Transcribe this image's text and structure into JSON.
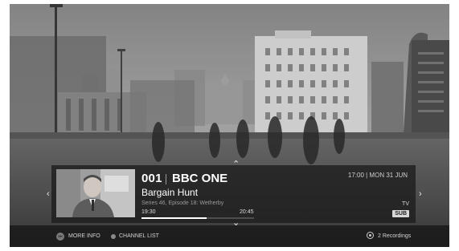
{
  "channel": {
    "number": "001",
    "name": "BBC ONE"
  },
  "programme": {
    "title": "Bargain Hunt",
    "description": "Series 46, Episode 18: Wetherby",
    "start_time": "19:30",
    "end_time": "20:45",
    "progress": 0.58
  },
  "clock": "17:00 | MON 31 JUN",
  "badges": {
    "tv": "TV",
    "sub": "SUB"
  },
  "footer": {
    "ok_label": "OK",
    "more_info": "MORE INFO",
    "channel_list": "CHANNEL LIST",
    "recordings": "2 Recordings"
  },
  "icons": {
    "up": "chevron-up-icon",
    "down": "chevron-down-icon",
    "left": "chevron-left-icon",
    "right": "chevron-right-icon",
    "recordings": "recordings-icon"
  }
}
